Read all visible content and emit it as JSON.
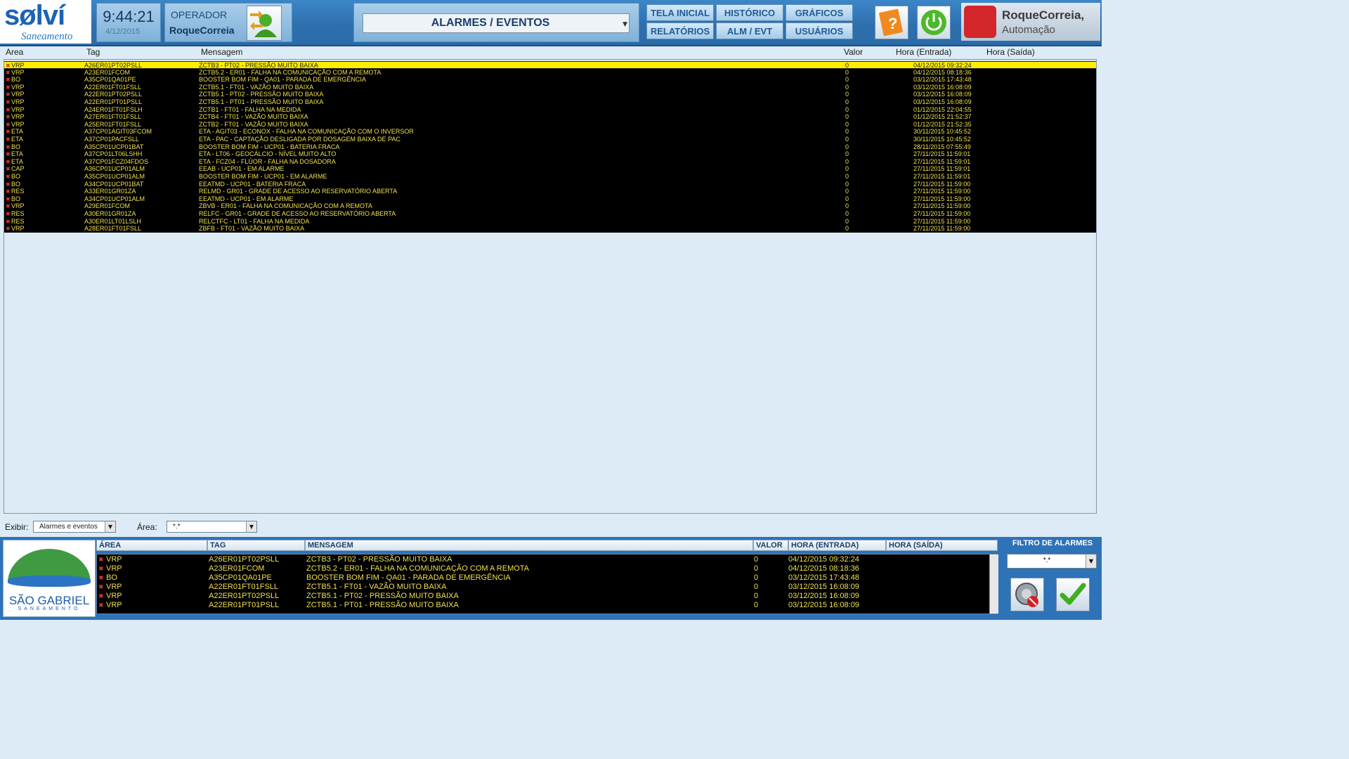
{
  "header": {
    "logo_word": "sølví",
    "logo_sub": "Saneamento",
    "time": "9:44:21",
    "date": "4/12/2015",
    "operator_label": "OPERADOR",
    "operator_name": "RoqueCorreia",
    "screen_selector": "ALARMES / EVENTOS",
    "nav": [
      "TELA INICIAL",
      "HISTÓRICO",
      "GRÁFICOS",
      "RELATÓRIOS",
      "ALM / EVT",
      "USUÁRIOS"
    ],
    "brand_name": "RoqueCorreia,",
    "brand_sub": "Automação"
  },
  "main_table": {
    "columns": [
      "Area",
      "Tag",
      "Mensagem",
      "Valor",
      "Hora (Entrada)",
      "Hora (Saída)"
    ],
    "rows": [
      [
        "VRP",
        "A26ER01PT02PSLL",
        "ZCTB3 - PT02 - PRESSÃO MUITO BAIXA",
        "0",
        "04/12/2015 09:32:24"
      ],
      [
        "VRP",
        "A23ER01FCOM",
        "ZCTB5.2 - ER01 - FALHA NA COMUNICAÇÃO COM A REMOTA",
        "0",
        "04/12/2015 08:18:36"
      ],
      [
        "BO",
        "A35CP01QA01PE",
        "BOOSTER BOM FIM - QA01 - PARADA DE EMERGÊNCIA",
        "0",
        "03/12/2015 17:43:48"
      ],
      [
        "VRP",
        "A22ER01FT01FSLL",
        "ZCTB5.1 - FT01 - VAZÃO MUITO BAIXA",
        "0",
        "03/12/2015 16:08:09"
      ],
      [
        "VRP",
        "A22ER01PT02PSLL",
        "ZCTB5.1 - PT02 - PRESSÃO MUITO BAIXA",
        "0",
        "03/12/2015 16:08:09"
      ],
      [
        "VRP",
        "A22ER01PT01PSLL",
        "ZCTB5.1 - PT01 - PRESSÃO MUITO BAIXA",
        "0",
        "03/12/2015 16:08:09"
      ],
      [
        "VRP",
        "A24ER01FT01FSLH",
        "ZCTB1 - FT01 - FALHA NA MEDIDA",
        "0",
        "01/12/2015 22:04:55"
      ],
      [
        "VRP",
        "A27ER01FT01FSLL",
        "ZCTB4 - FT01 - VAZÃO MUITO BAIXA",
        "0",
        "01/12/2015 21:52:37"
      ],
      [
        "VRP",
        "A25ER01FT01FSLL",
        "ZCTB2 - FT01 - VAZÃO MUITO BAIXA",
        "0",
        "01/12/2015 21:52:35"
      ],
      [
        "ETA",
        "A37CP01AGIT03FCOM",
        "ETA - AGIT03 - ECONOX - FALHA NA COMUNICAÇÃO COM O INVERSOR",
        "0",
        "30/11/2015 10:45:52"
      ],
      [
        "ETA",
        "A37CP01PACFSLL",
        "ETA - PAC - CAPTAÇÃO DESLIGADA POR DOSAGEM BAIXA DE PAC",
        "0",
        "30/11/2015 10:45:52"
      ],
      [
        "BO",
        "A35CP01UCP01BAT",
        "BOOSTER BOM FIM - UCP01 - BATERIA FRACA",
        "0",
        "28/11/2015 07:55:49"
      ],
      [
        "ETA",
        "A37CP01LT06LSHH",
        "ETA - LT06 - GEOCÁLCIO - NÍVEL MUITO ALTO",
        "0",
        "27/11/2015 11:59:01"
      ],
      [
        "ETA",
        "A37CP01FCZ04FDOS",
        "ETA - FCZ04 - FLÚOR - FALHA NA DOSADORA",
        "0",
        "27/11/2015 11:59:01"
      ],
      [
        "CAP",
        "A36CP01UCP01ALM",
        "EEAB - UCP01 - EM ALARME",
        "0",
        "27/11/2015 11:59:01"
      ],
      [
        "BO",
        "A35CP01UCP01ALM",
        "BOOSTER BOM FIM - UCP01 - EM ALARME",
        "0",
        "27/11/2015 11:59:01"
      ],
      [
        "BO",
        "A34CP01UCP01BAT",
        "EEATMD - UCP01 - BATERIA FRACA",
        "0",
        "27/11/2015 11:59:00"
      ],
      [
        "RES",
        "A33ER01GR01ZA",
        "RELMD - GR01 - GRADE DE ACESSO AO RESERVATÓRIO ABERTA",
        "0",
        "27/11/2015 11:59:00"
      ],
      [
        "BO",
        "A34CP01UCP01ALM",
        "EEATMD - UCP01 - EM ALARME",
        "0",
        "27/11/2015 11:59:00"
      ],
      [
        "VRP",
        "A29ER01FCOM",
        "ZBVB - ER01 - FALHA NA COMUNICAÇÃO COM A REMOTA",
        "0",
        "27/11/2015 11:59:00"
      ],
      [
        "RES",
        "A30ER01GR01ZA",
        "RELFC - GR01 - GRADE DE ACESSO AO RESERVATÓRIO ABERTA",
        "0",
        "27/11/2015 11:59:00"
      ],
      [
        "RES",
        "A30ER01LT01LSLH",
        "RELCTFC - LT01 - FALHA NA MEDIDA",
        "0",
        "27/11/2015 11:59:00"
      ],
      [
        "VRP",
        "A28ER01FT01FSLL",
        "ZBFB - FT01 - VAZÃO MUITO BAIXA",
        "0",
        "27/11/2015 11:59:00"
      ]
    ]
  },
  "filters": {
    "show_label": "Exibir:",
    "show_value": "Alarmes e eventos",
    "area_label": "Área:",
    "area_value": "*.*"
  },
  "bottom": {
    "logo_name": "SÃO GABRIEL",
    "logo_sub": "SANEAMENTO",
    "columns": [
      "ÁREA",
      "TAG",
      "MENSAGEM",
      "VALOR",
      "HORA (ENTRADA)",
      "HORA (SAÍDA)"
    ],
    "rows": [
      [
        "VRP",
        "A26ER01PT02PSLL",
        "ZCTB3 - PT02 - PRESSÃO MUITO BAIXA",
        "0",
        "04/12/2015 09:32:24"
      ],
      [
        "VRP",
        "A23ER01FCOM",
        "ZCTB5.2 - ER01 - FALHA NA COMUNICAÇÃO COM A REMOTA",
        "0",
        "04/12/2015 08:18:36"
      ],
      [
        "BO",
        "A35CP01QA01PE",
        "BOOSTER BOM FIM - QA01 - PARADA DE EMERGÊNCIA",
        "0",
        "03/12/2015 17:43:48"
      ],
      [
        "VRP",
        "A22ER01FT01FSLL",
        "ZCTB5.1 - FT01 - VAZÃO MUITO BAIXA",
        "0",
        "03/12/2015 16:08:09"
      ],
      [
        "VRP",
        "A22ER01PT02PSLL",
        "ZCTB5.1 - PT02 - PRESSÃO MUITO BAIXA",
        "0",
        "03/12/2015 16:08:09"
      ],
      [
        "VRP",
        "A22ER01PT01PSLL",
        "ZCTB5.1 - PT01 - PRESSÃO MUITO BAIXA",
        "0",
        "03/12/2015 16:08:09"
      ]
    ],
    "filter_title": "FILTRO DE ALARMES",
    "filter_value": "*.*"
  }
}
